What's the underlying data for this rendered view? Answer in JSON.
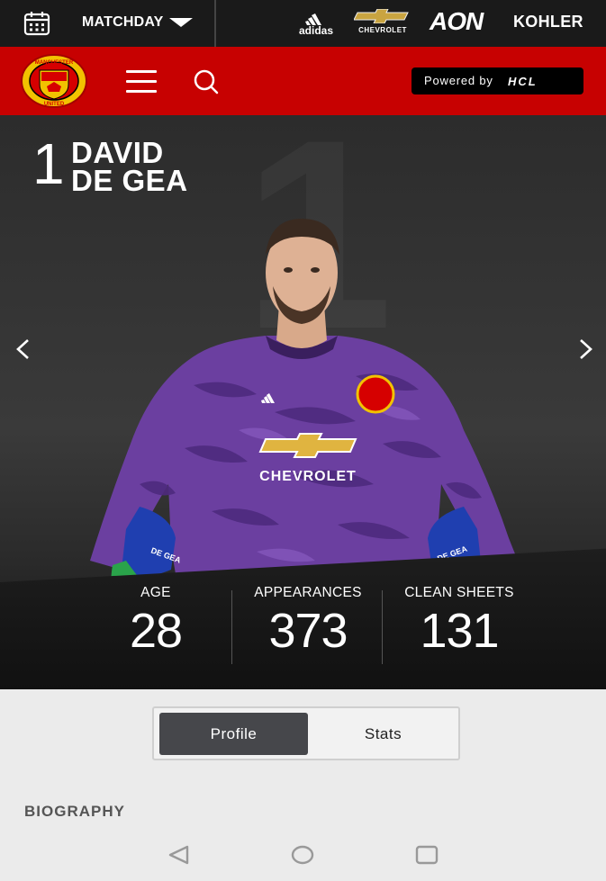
{
  "topbar": {
    "matchday_label": "MATCHDAY",
    "sponsors": {
      "adidas": "adidas",
      "chevrolet": "CHEVROLET",
      "aon": "AON",
      "kohler": "KOHLER"
    }
  },
  "header": {
    "powered_by": "Powered by",
    "powered_brand": "HCL",
    "crest_text_top": "MANCHESTER",
    "crest_text_bottom": "UNITED"
  },
  "player": {
    "number": "1",
    "first_name": "DAVID",
    "last_name": "DE GEA",
    "background_number": "1",
    "kit_sponsor": "CHEVROLET",
    "glove_text": "DE GEA"
  },
  "stats": [
    {
      "label": "AGE",
      "value": "28"
    },
    {
      "label": "APPEARANCES",
      "value": "373"
    },
    {
      "label": "CLEAN SHEETS",
      "value": "131"
    }
  ],
  "tabs": [
    {
      "label": "Profile",
      "active": true
    },
    {
      "label": "Stats",
      "active": false
    }
  ],
  "section_title": "BIOGRAPHY",
  "colors": {
    "brand_red": "#c70101",
    "topbar": "#1a1a1a",
    "active_tab": "#46474b",
    "kit_purple": "#6b3fa0"
  },
  "icons": {
    "calendar": "calendar-icon",
    "dropdown": "chevron-down-icon",
    "menu": "hamburger-menu-icon",
    "search": "search-icon",
    "prev": "chevron-left-icon",
    "next": "chevron-right-icon",
    "nav_back": "triangle-back-icon",
    "nav_home": "circle-home-icon",
    "nav_recent": "square-recent-icon"
  }
}
